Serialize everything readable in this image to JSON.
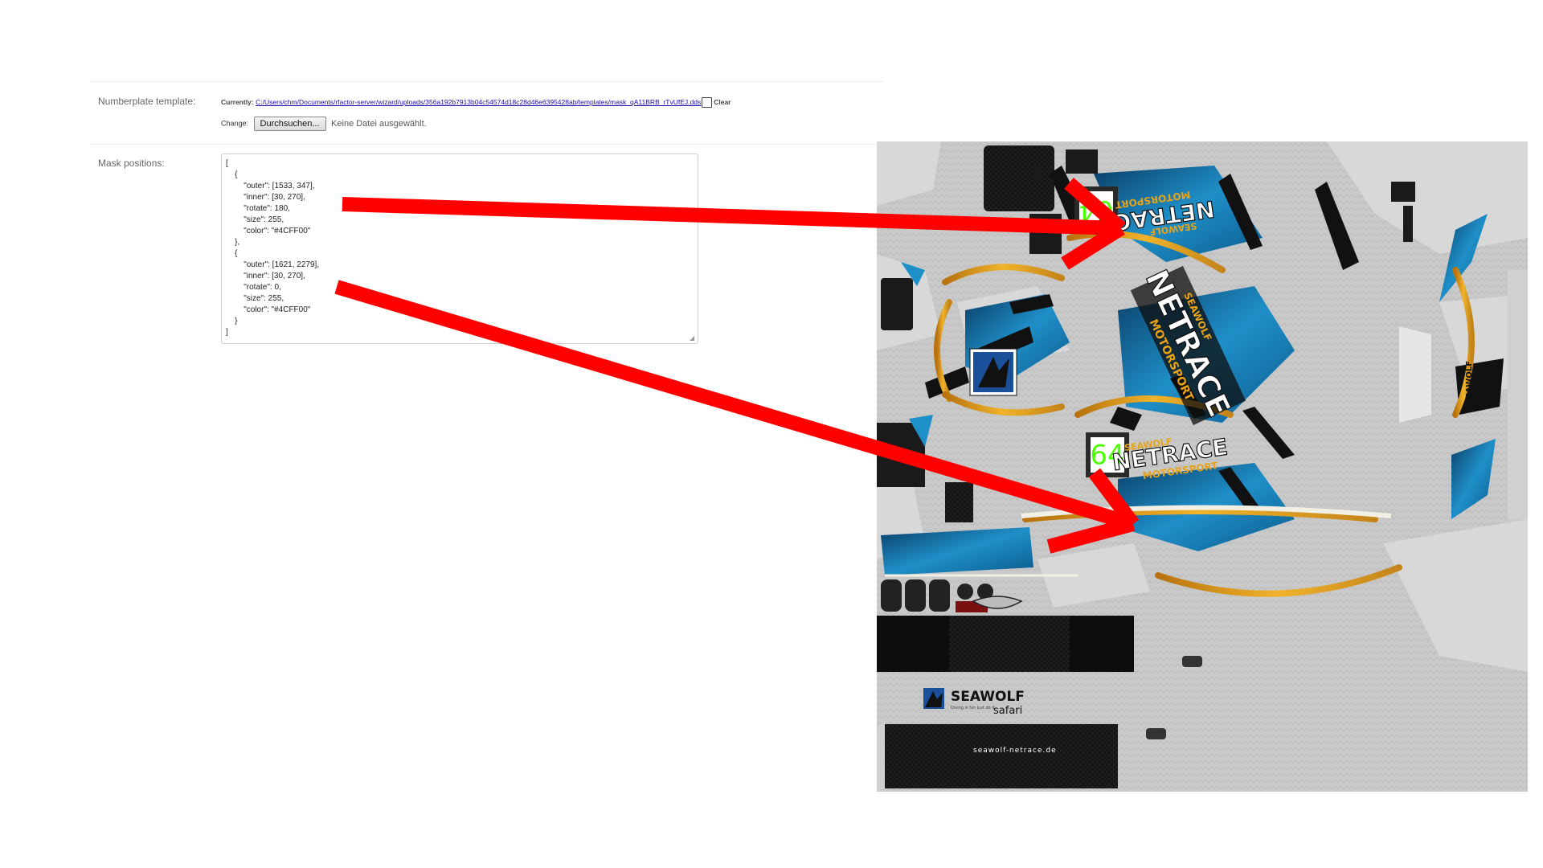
{
  "form": {
    "numberplate": {
      "label": "Numberplate template:",
      "currently_label": "Currently:",
      "file_path": "C:/Users/chm/Documents/rfactor-server/wizard/uploads/356a192b7913b04c54574d18c28d46e6395428ab/templates/mask_qA11BRB_rTvUfEJ.dds",
      "clear_label": "Clear",
      "change_label": "Change:",
      "browse_button": "Durchsuchen...",
      "no_file_text": "Keine Datei ausgewählt."
    },
    "mask_positions": {
      "label": "Mask positions:",
      "value": "[\n    {\n        \"outer\": [1533, 347],\n        \"inner\": [30, 270],\n        \"rotate\": 180,\n        \"size\": 255,\n        \"color\": \"#4CFF00\"\n    },\n    {\n        \"outer\": [1621, 2279],\n        \"inner\": [30, 270],\n        \"rotate\": 0,\n        \"size\": 255,\n        \"color\": \"#4CFF00\"\n    }\n]"
    }
  },
  "livery": {
    "plate_top_number": "64",
    "plate_bottom_number": "64",
    "plate_color": "#4CFF00",
    "brand_top": "NETRACE",
    "brand_top_sub": "SEAWOLF",
    "brand_top_motorsport": "MOTORSPORT",
    "brand_mid": "NETRACE",
    "brand_mid_sub": "SEAWOLF",
    "brand_mid_motorsport": "MOTORSPORT",
    "brand_bottom": "NETRACE",
    "brand_bottom_sub": "SEAWOLF",
    "brand_bottom_motorsport": "MOTORSPORT",
    "seawolf_logo": "SEAWOLF",
    "seawolf_tagline": "Diving is fun just do it",
    "safari": "safari",
    "url": "seawolf-netrace.de",
    "side_seawolf": "SEAWOLF",
    "side_safari": "safari"
  },
  "colors": {
    "arrow": "#ff0000",
    "accent_blue": "#1e7fb8",
    "accent_yellow": "#e8a317",
    "black": "#111111"
  }
}
